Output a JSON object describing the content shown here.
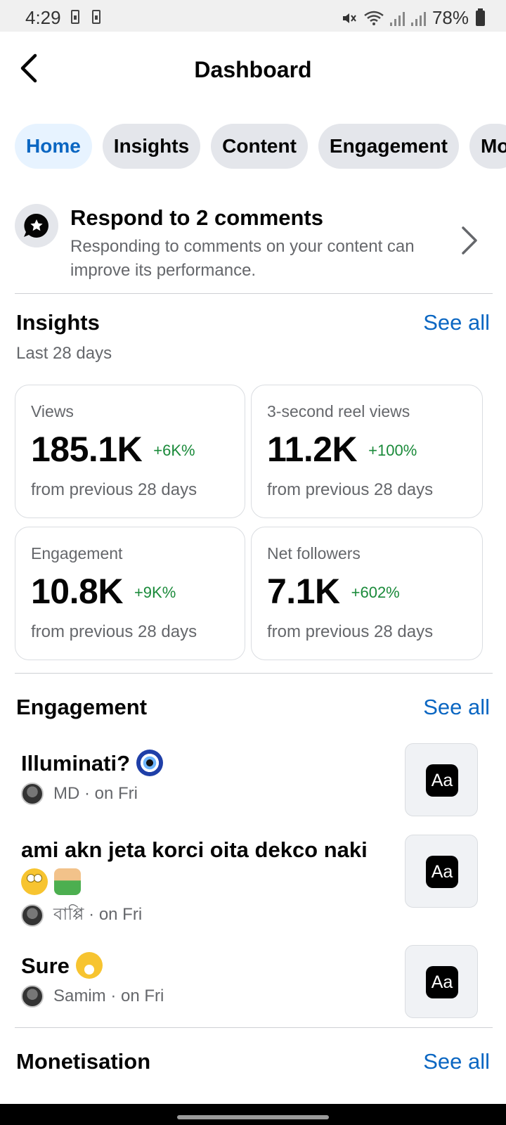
{
  "status_bar": {
    "time": "4:29",
    "battery": "78%"
  },
  "header": {
    "title": "Dashboard"
  },
  "tabs": [
    {
      "label": "Home",
      "active": true
    },
    {
      "label": "Insights",
      "active": false
    },
    {
      "label": "Content",
      "active": false
    },
    {
      "label": "Engagement",
      "active": false
    },
    {
      "label": "Mo",
      "active": false
    }
  ],
  "respond": {
    "title": "Respond to 2 comments",
    "description": "Responding to comments on your content can improve its performance."
  },
  "insights": {
    "title": "Insights",
    "see_all": "See all",
    "subtitle": "Last 28 days",
    "cards": [
      {
        "label": "Views",
        "value": "185.1K",
        "change": "+6K%",
        "footer": "from previous 28 days"
      },
      {
        "label": "3-second reel views",
        "value": "11.2K",
        "change": "+100%",
        "footer": "from previous 28 days"
      },
      {
        "label": "Engagement",
        "value": "10.8K",
        "change": "+9K%",
        "footer": "from previous 28 days"
      },
      {
        "label": "Net followers",
        "value": "7.1K",
        "change": "+602%",
        "footer": "from previous 28 days"
      }
    ]
  },
  "engagement": {
    "title": "Engagement",
    "see_all": "See all",
    "items": [
      {
        "text": "Illuminati?",
        "emoji_icons": [
          "evil-eye-icon"
        ],
        "author": "MD",
        "time": "· on Fri",
        "thumb_text": "Aa"
      },
      {
        "text": "ami akn jeta korci oita dekco naki",
        "emoji_icons": [
          "eyeroll-icon",
          "facepalm-icon"
        ],
        "author": "বাপ্পি",
        "time": "· on Fri",
        "thumb_text": "Aa"
      },
      {
        "text": "Sure",
        "emoji_icons": [
          "yawn-icon"
        ],
        "author": "Samim",
        "time": "· on Fri",
        "thumb_text": "Aa"
      }
    ]
  },
  "monetisation": {
    "title": "Monetisation",
    "see_all": "See all"
  },
  "colors": {
    "accent": "#0a66c2",
    "positive": "#1a8a3a",
    "active_tab_bg": "#e7f3ff"
  }
}
